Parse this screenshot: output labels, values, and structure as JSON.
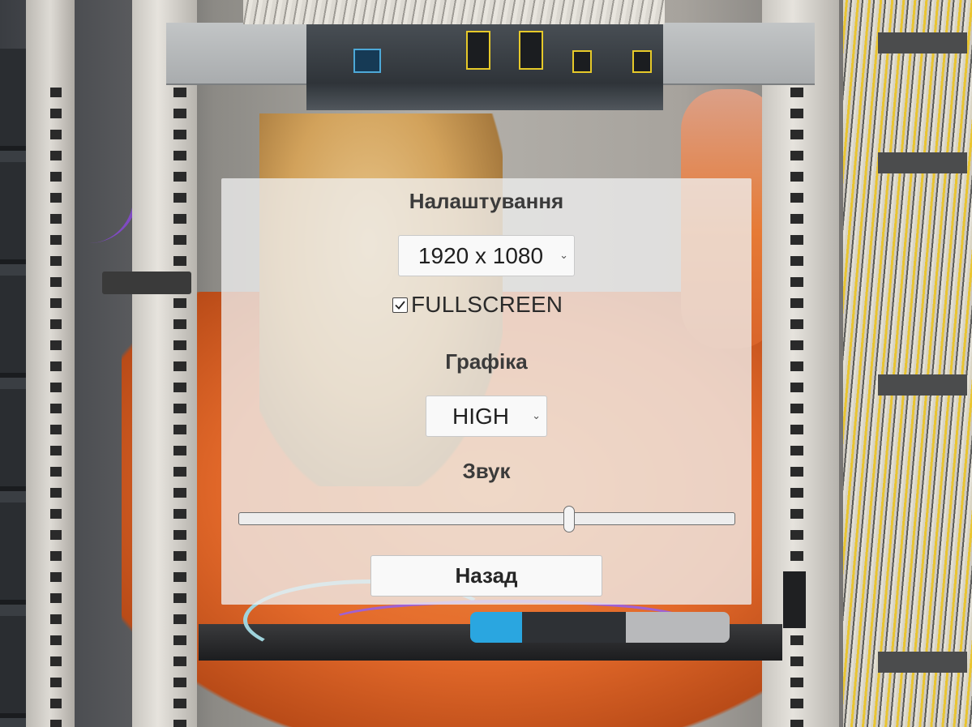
{
  "settings": {
    "title": "Налаштування",
    "resolution": {
      "selected": "1920 x 1080"
    },
    "fullscreen": {
      "label": "FULLSCREEN",
      "checked": true
    },
    "graphics": {
      "title": "Графіка",
      "selected": "HIGH"
    },
    "sound": {
      "title": "Звук",
      "volume": 0.67
    },
    "back_label": "Назад"
  },
  "icons": {
    "dropdown": "chevron-down-icon",
    "check": "checkmark-icon"
  },
  "colors": {
    "panel_background": "#eeeeee",
    "text": "#3b3b3b",
    "control_background": "#f9f9f9"
  }
}
